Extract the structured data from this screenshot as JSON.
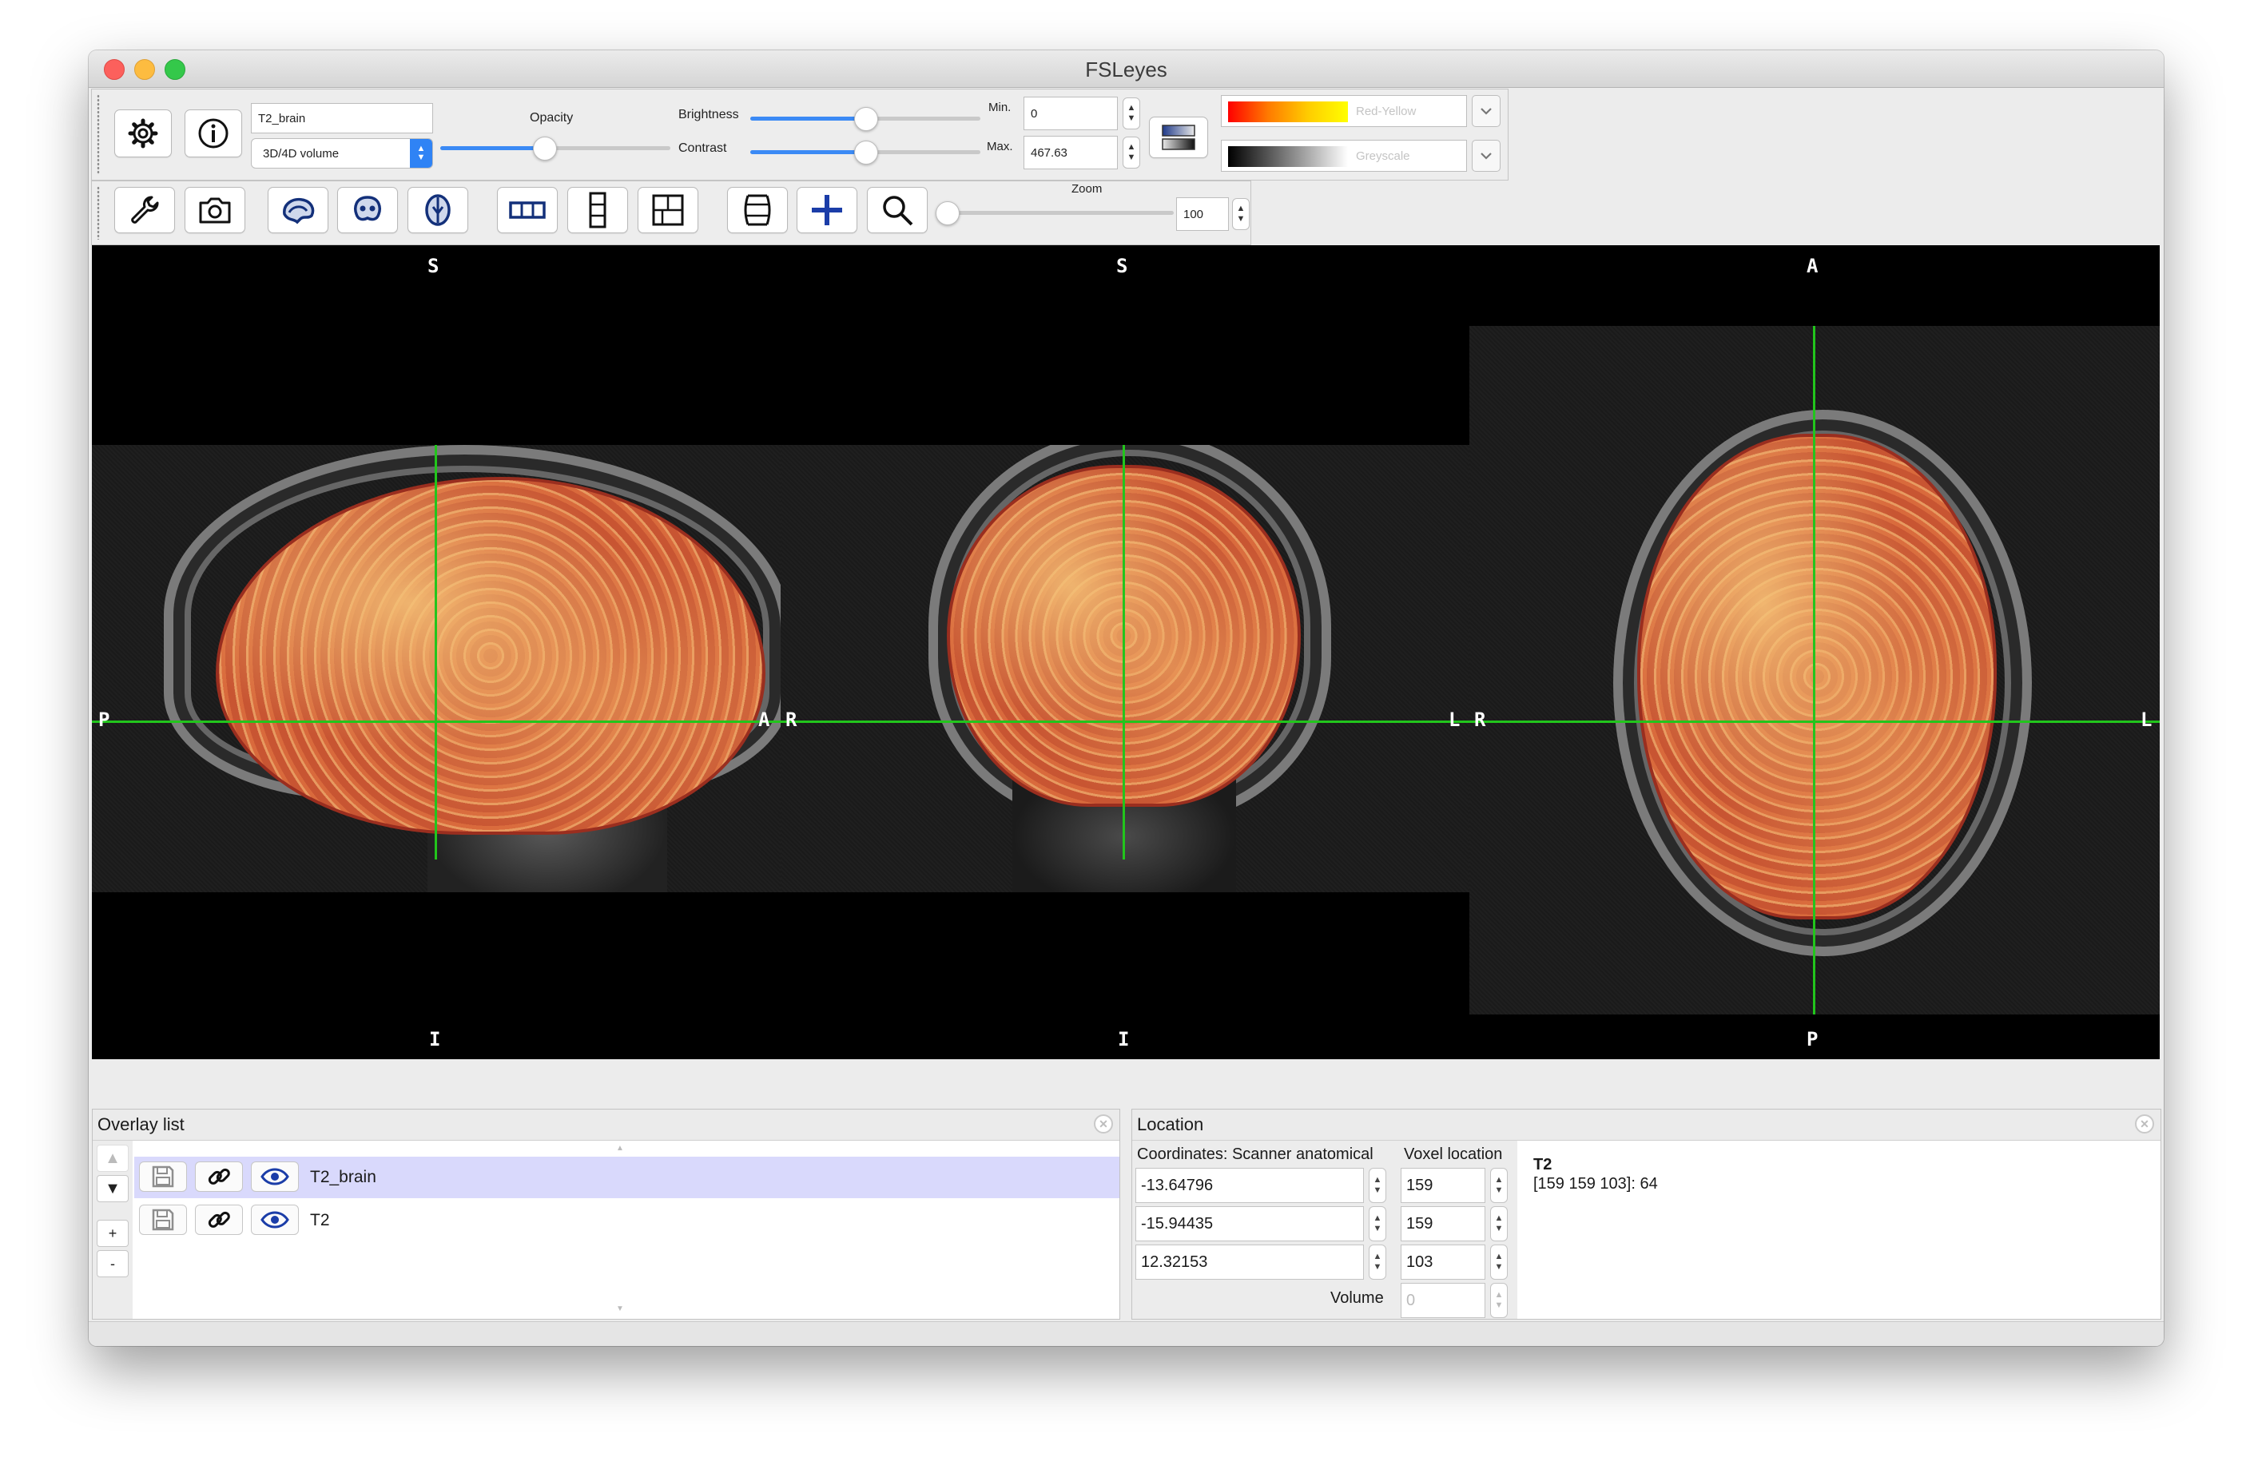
{
  "window": {
    "title": "FSLeyes"
  },
  "toolbar_overlay": {
    "overlay_name": "T2_brain",
    "overlay_type": "3D/4D volume",
    "opacity_label": "Opacity",
    "opacity_value": 0.45,
    "brightness_label": "Brightness",
    "brightness_value": 0.5,
    "contrast_label": "Contrast",
    "contrast_value": 0.5,
    "min_label": "Min.",
    "min_value": "0",
    "max_label": "Max.",
    "max_value": "467.63",
    "cmap_primary": "Red-Yellow",
    "cmap_secondary": "Greyscale"
  },
  "toolbar_view": {
    "zoom_label": "Zoom",
    "zoom_value": "100"
  },
  "canvas": {
    "sagittal": {
      "top": "S",
      "bottom": "I",
      "left": "P",
      "right": "A"
    },
    "coronal": {
      "top": "S",
      "bottom": "I",
      "left": "R",
      "right": "L"
    },
    "axial": {
      "top": "A",
      "bottom": "P",
      "left": "R",
      "right": "L"
    },
    "crosshair_color": "#22c51c"
  },
  "overlay_list": {
    "title": "Overlay list",
    "items": [
      {
        "name": "T2_brain",
        "selected": true
      },
      {
        "name": "T2",
        "selected": false
      }
    ],
    "add_label": "+",
    "remove_label": "-"
  },
  "location": {
    "title": "Location",
    "coords_header": "Coordinates: Scanner anatomical",
    "voxel_header": "Voxel location",
    "coords": [
      "-13.64796",
      "-15.94435",
      "12.32153"
    ],
    "voxels": [
      "159",
      "159",
      "103"
    ],
    "volume_label": "Volume",
    "volume_value": "0",
    "info_title": "T2",
    "info_value": "[159 159 103]: 64"
  },
  "colors": {
    "accent": "#2f83f5",
    "selection": "#d9d9fc"
  }
}
